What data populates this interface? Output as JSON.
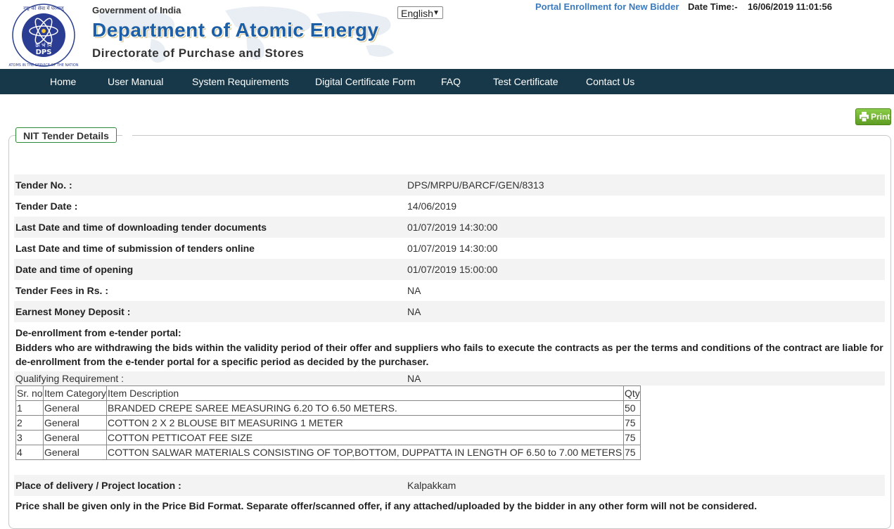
{
  "header": {
    "emblem_text_top": "राष्ट्र की सेवा में परमाणु",
    "emblem_text_bottom": "ATOMS IN THE SERVICE OF THE NATION",
    "logo_hindi": "क्र भं नि",
    "logo_abbr": "DPS",
    "gov": "Government of India",
    "department": "Department of Atomic Energy",
    "directorate": "Directorate of Purchase and Stores",
    "language": "English",
    "enroll_link": "Portal Enrollment for New Bidder",
    "date_time_label": "Date Time:-",
    "date_time_value": "16/06/2019 11:01:56"
  },
  "nav": {
    "items": [
      "Home",
      "User Manual",
      "System Requirements",
      "Digital Certificate Form",
      "FAQ",
      "Test Certificate",
      "Contact Us"
    ]
  },
  "print_label": "Print",
  "panel": {
    "legend": "NIT Tender Details",
    "fields": [
      {
        "label": "Tender No. :",
        "value": "DPS/MRPU/BARCF/GEN/8313"
      },
      {
        "label": "Tender Date :",
        "value": "14/06/2019"
      },
      {
        "label": "Last Date and time of downloading tender documents",
        "value": "01/07/2019 14:30:00"
      },
      {
        "label": "Last Date and time of submission of tenders online",
        "value": "01/07/2019 14:30:00"
      },
      {
        "label": "Date and time of opening",
        "value": "01/07/2019 15:00:00"
      },
      {
        "label": "Tender Fees in Rs. :",
        "value": "NA"
      },
      {
        "label": "Earnest Money Deposit :",
        "value": "NA"
      }
    ],
    "deenrollment_title": "De-enrollment from e-tender portal:",
    "deenrollment_text": "Bidders who are withdrawing the bids within the validity period of their offer and suppliers who fails to execute the contracts as per the terms and conditions of the contract are liable for de-enrollment from the e-tender portal for a specific period as decided by the purchaser.",
    "qualifying_label": "Qualifying Requirement :",
    "qualifying_value": "NA",
    "items_table": {
      "headers": [
        "Sr. no",
        "Item Category",
        "Item Description",
        "Qty"
      ],
      "rows": [
        [
          "1",
          "General",
          "BRANDED CREPE SAREE MEASURING 6.20 TO 6.50 METERS.",
          "50"
        ],
        [
          "2",
          "General",
          "COTTON 2 X 2 BLOUSE BIT MEASURING 1 METER",
          "75"
        ],
        [
          "3",
          "General",
          "COTTON PETTICOAT FEE SIZE",
          "75"
        ],
        [
          "4",
          "General",
          "COTTON SALWAR MATERIALS CONSISTING OF TOP,BOTTOM, DUPPATTA IN LENGTH OF 6.50 to 7.00 METERS",
          "75"
        ]
      ]
    },
    "place_label": "Place of delivery / Project location :",
    "place_value": "Kalpakkam",
    "price_note": "Price shall be given only in the Price Bid Format. Separate offer/scanned offer, if any attached/uploaded by the bidder in any other form will not be considered."
  },
  "colors": {
    "nav_bg": "#163849",
    "department_blue": "#1d5fa6",
    "enroll_link": "#3a7bbf",
    "print_green": "#6db230",
    "legend_border": "#2f8a35"
  }
}
